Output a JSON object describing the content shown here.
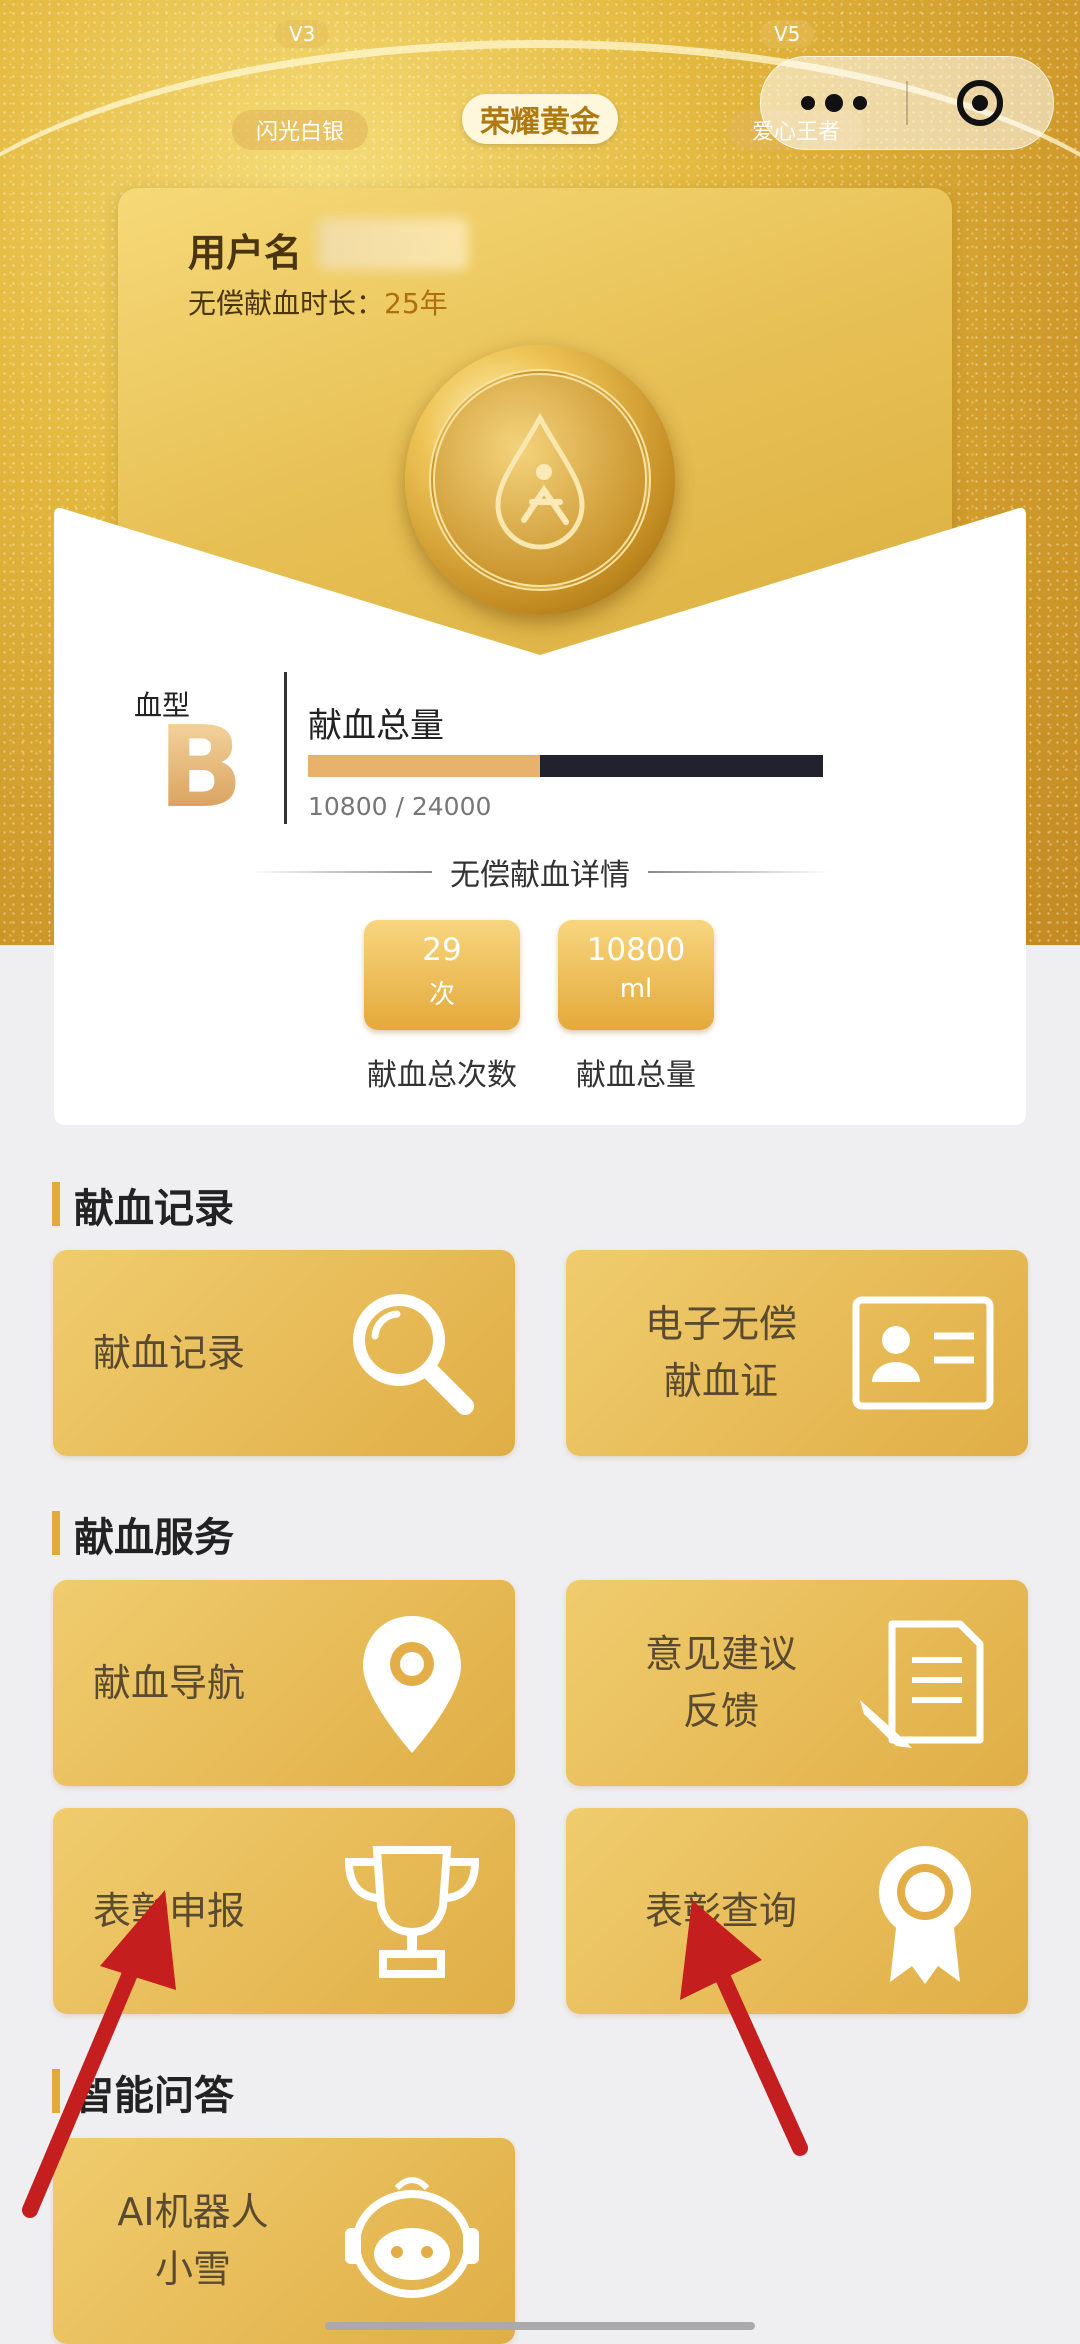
{
  "header": {
    "levels": [
      {
        "code": "V3",
        "name": "闪光白银"
      },
      {
        "code": "V5",
        "name": "爱心王者"
      }
    ],
    "current_level": "荣耀黄金"
  },
  "card": {
    "username_label": "用户名",
    "duration_label": "无偿献血时长：",
    "duration_value": "25年"
  },
  "blood": {
    "type_label": "血型",
    "type_value": "B",
    "volume_title": "献血总量",
    "progress_text": "10800 / 24000",
    "progress_fraction": 0.45
  },
  "detail": {
    "title": "无偿献血详情",
    "stats": [
      {
        "value": "29",
        "unit": "次",
        "label": "献血总次数"
      },
      {
        "value": "10800",
        "unit": "ml",
        "label": "献血总量"
      }
    ]
  },
  "sections": [
    {
      "title": "献血记录",
      "tiles": [
        {
          "label": "献血记录",
          "icon": "magnifier-icon"
        },
        {
          "label": "电子无偿\n献血证",
          "icon": "id-card-icon"
        }
      ]
    },
    {
      "title": "献血服务",
      "tiles": [
        {
          "label": "献血导航",
          "icon": "location-pin-icon"
        },
        {
          "label": "意见建议\n反馈",
          "icon": "document-pen-icon"
        },
        {
          "label": "表彰申报",
          "icon": "trophy-icon"
        },
        {
          "label": "表彰查询",
          "icon": "award-ribbon-icon"
        }
      ]
    },
    {
      "title": "智能问答",
      "tiles": [
        {
          "label": "AI机器人\n小雪",
          "icon": "robot-icon"
        }
      ]
    }
  ],
  "colors": {
    "accent": "#e3a93a",
    "arrow": "#c41e1e",
    "tile": "#e6b850"
  }
}
